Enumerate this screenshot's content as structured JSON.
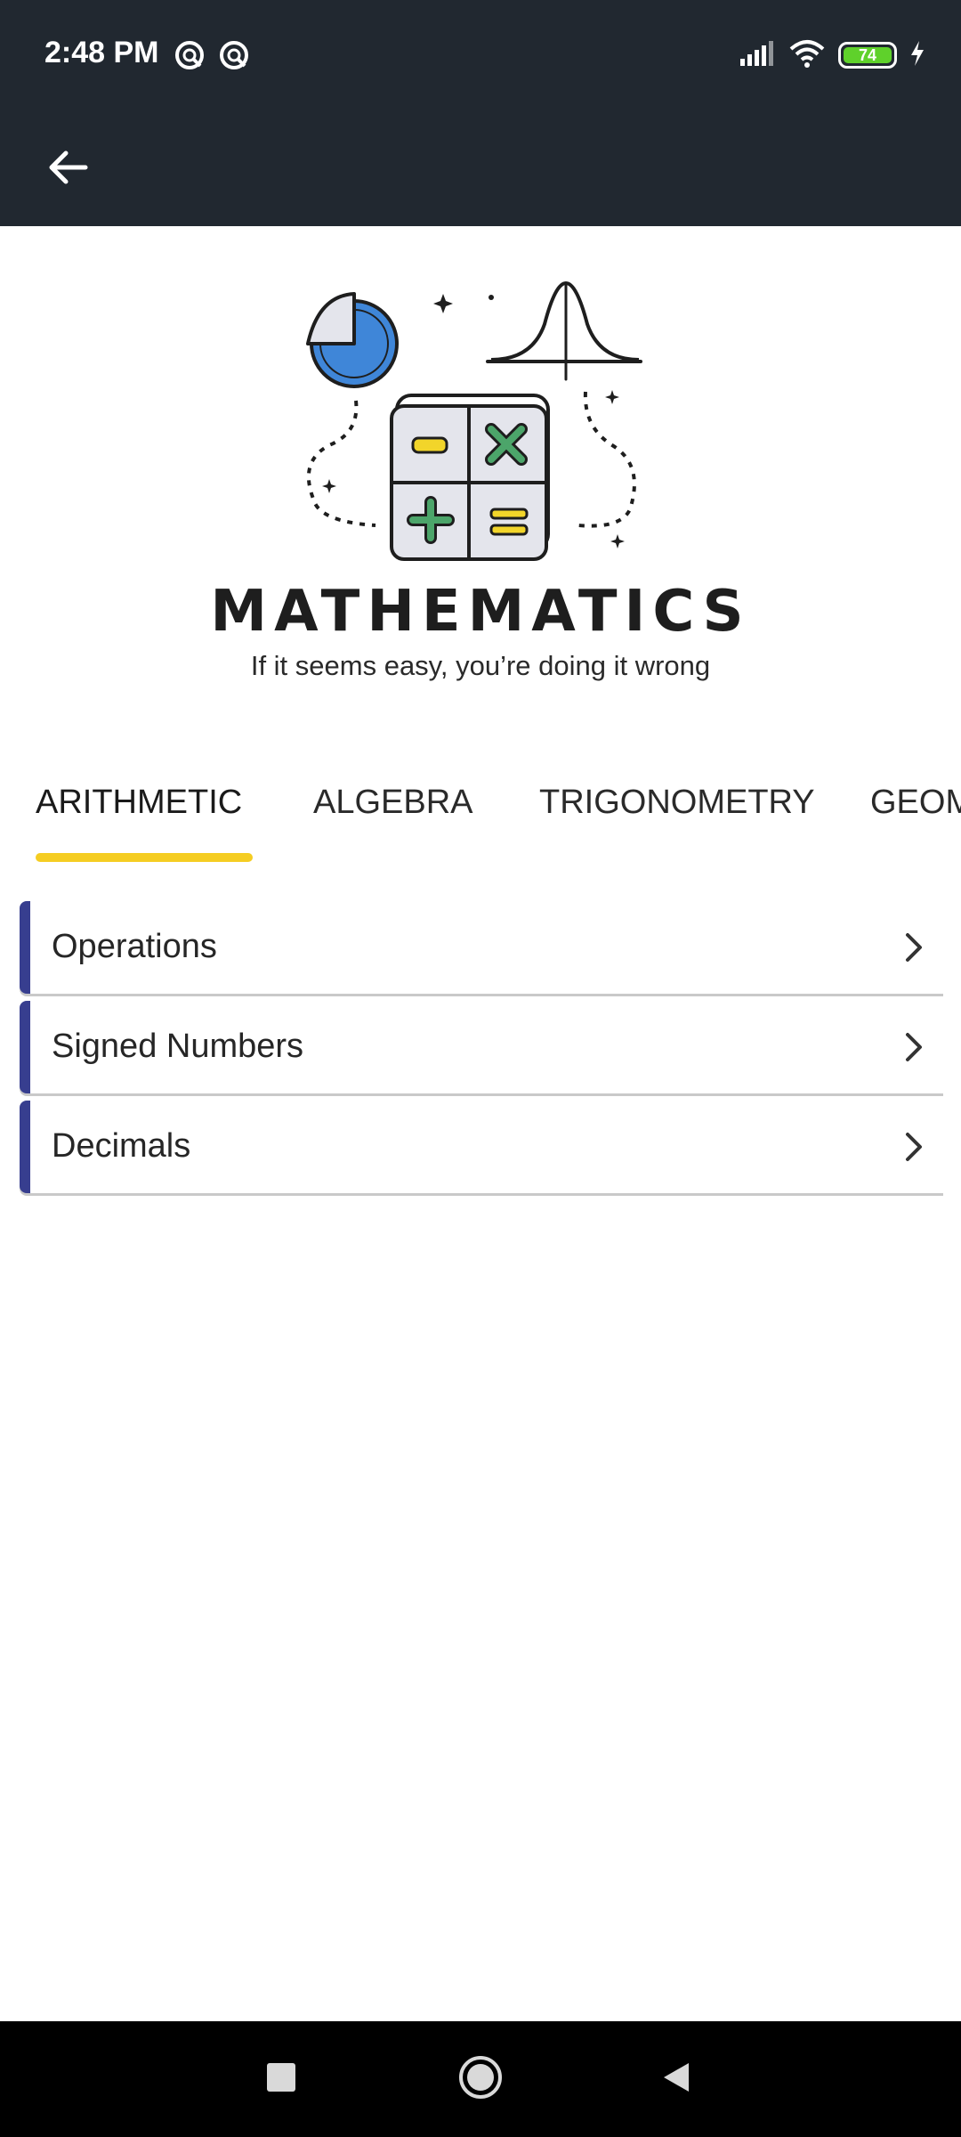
{
  "status_bar": {
    "time": "2:48 PM",
    "battery_level": "74",
    "icons": [
      "app-notification-icon",
      "app-notification-icon",
      "signal-icon",
      "wifi-icon",
      "battery-icon",
      "charging-icon"
    ]
  },
  "toolbar": {
    "back_icon": "arrow-left-icon"
  },
  "header": {
    "title": "MATHEMATICS",
    "subtitle": "If it seems easy, you’re doing it wrong"
  },
  "tabs": [
    {
      "label": "ARITHMETIC",
      "active": true
    },
    {
      "label": "ALGEBRA",
      "active": false
    },
    {
      "label": "TRIGONOMETRY",
      "active": false
    },
    {
      "label": "GEOM",
      "active": false
    }
  ],
  "topics": [
    {
      "label": "Operations"
    },
    {
      "label": "Signed Numbers"
    },
    {
      "label": "Decimals"
    }
  ],
  "colors": {
    "app_bar": "#212830",
    "tab_indicator": "#f5cd22",
    "list_accent": "#373e8f"
  }
}
